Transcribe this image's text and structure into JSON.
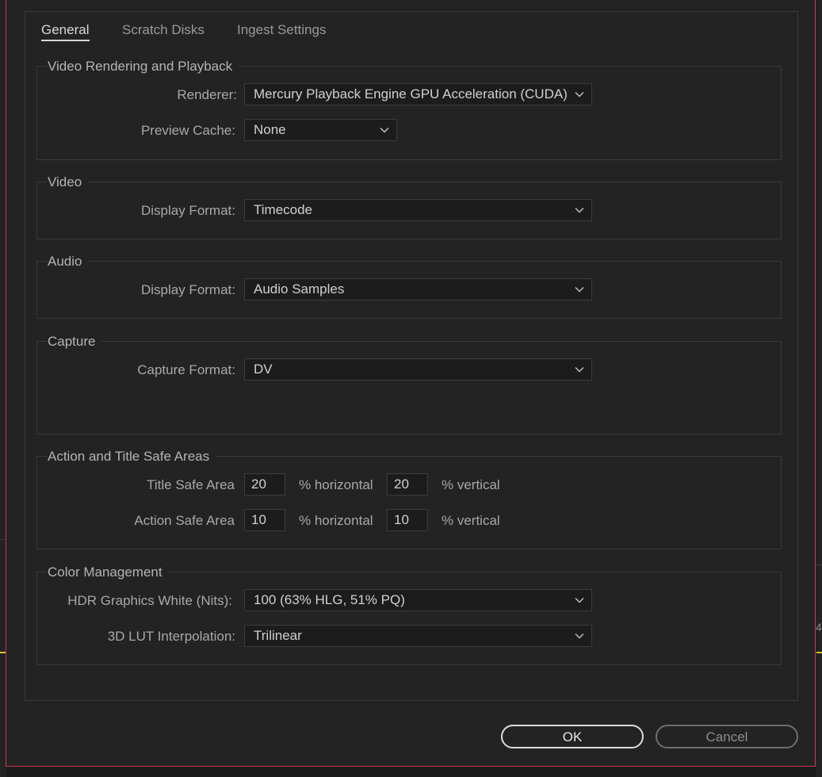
{
  "tabs": [
    {
      "label": "General",
      "active": true
    },
    {
      "label": "Scratch Disks",
      "active": false
    },
    {
      "label": "Ingest Settings",
      "active": false
    }
  ],
  "video_rendering": {
    "title": "Video Rendering and Playback",
    "renderer_label": "Renderer:",
    "renderer_value": "Mercury Playback Engine GPU Acceleration (CUDA)",
    "preview_cache_label": "Preview Cache:",
    "preview_cache_value": "None"
  },
  "video": {
    "title": "Video",
    "display_format_label": "Display Format:",
    "display_format_value": "Timecode"
  },
  "audio": {
    "title": "Audio",
    "display_format_label": "Display Format:",
    "display_format_value": "Audio Samples"
  },
  "capture": {
    "title": "Capture",
    "capture_format_label": "Capture Format:",
    "capture_format_value": "DV"
  },
  "safe_areas": {
    "title": "Action and Title Safe Areas",
    "title_safe_label": "Title Safe Area",
    "title_safe_h": "20",
    "title_safe_v": "20",
    "action_safe_label": "Action Safe Area",
    "action_safe_h": "10",
    "action_safe_v": "10",
    "horizontal_unit": "% horizontal",
    "vertical_unit": "% vertical"
  },
  "color_management": {
    "title": "Color Management",
    "hdr_label": "HDR Graphics White (Nits):",
    "hdr_value": "100 (63% HLG, 51% PQ)",
    "lut_label": "3D LUT Interpolation:",
    "lut_value": "Trilinear"
  },
  "buttons": {
    "ok": "OK",
    "cancel": "Cancel"
  },
  "background": {
    "edge_digit": "4"
  },
  "colors": {
    "dialog_bg": "#232323",
    "border_accent": "#c43a52",
    "timeline_marker": "#d9c22e"
  }
}
